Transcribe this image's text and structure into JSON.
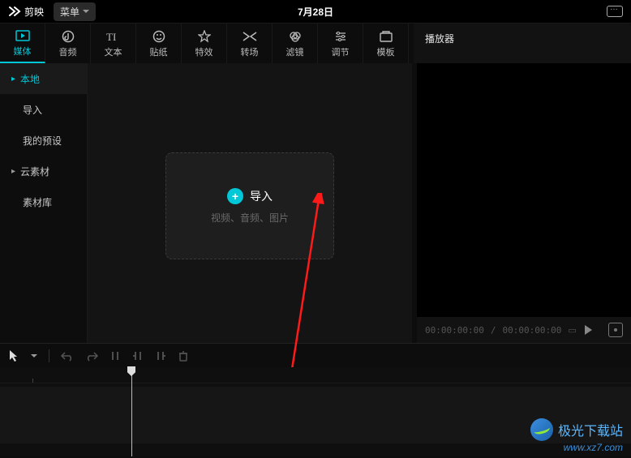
{
  "titlebar": {
    "app_name": "剪映",
    "menu_label": "菜单",
    "date": "7月28日"
  },
  "tabs": {
    "media": "媒体",
    "audio": "音频",
    "text": "文本",
    "sticker": "贴纸",
    "effect": "特效",
    "transition": "转场",
    "filter": "滤镜",
    "adjust": "调节",
    "template": "模板"
  },
  "player_label": "播放器",
  "sidebar": {
    "local": "本地",
    "import": "导入",
    "my_presets": "我的预设",
    "cloud": "云素材",
    "library": "素材库"
  },
  "import_box": {
    "title": "导入",
    "subtitle": "视频、音频、图片"
  },
  "player": {
    "time_current": "00:00:00:00",
    "time_sep": " / ",
    "time_total": "00:00:00:00"
  },
  "watermark": {
    "name": "极光下载站",
    "url": "www.xz7.com"
  }
}
